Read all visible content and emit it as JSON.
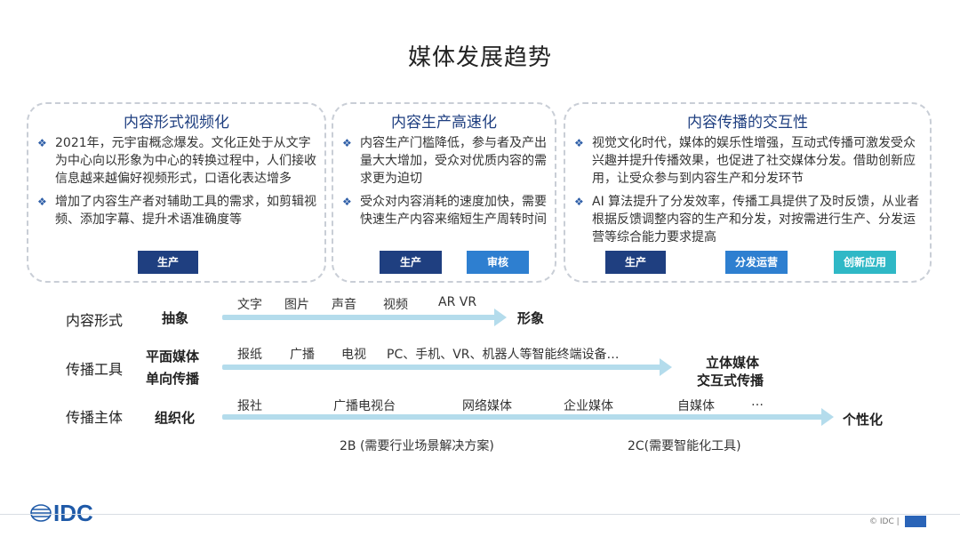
{
  "title": "媒体发展趋势",
  "panels": [
    {
      "title": "内容形式视频化",
      "bullets": [
        "2021年，元宇宙概念爆发。文化正处于从文字为中心向以形象为中心的转换过程中，人们接收信息越来越偏好视频形式，口语化表达增多",
        "增加了内容生产者对辅助工具的需求，如剪辑视频、添加字幕、提升术语准确度等"
      ],
      "tags": [
        "生产"
      ]
    },
    {
      "title": "内容生产高速化",
      "bullets": [
        "内容生产门槛降低，参与者及产出量大大增加，受众对优质内容的需求更为迫切",
        "受众对内容消耗的速度加快，需要快速生产内容来缩短生产周转时间"
      ],
      "tags": [
        "生产",
        "审核"
      ]
    },
    {
      "title": "内容传播的交互性",
      "bullets": [
        "视觉文化时代，媒体的娱乐性增强，互动式传播可激发受众兴趣并提升传播效果，也促进了社交媒体分发。借助创新应用，让受众参与到内容生产和分发环节",
        "AI 算法提升了分发效率，传播工具提供了及时反馈，从业者根据反馈调整内容的生产和分发，对按需进行生产、分发运营等综合能力要求提高"
      ],
      "tags": [
        "生产",
        "分发运营",
        "创新应用"
      ]
    }
  ],
  "bullet_icon": "diamond-bullet-icon",
  "rows": [
    {
      "label": "内容形式",
      "start": [
        "抽象"
      ],
      "items": [
        "文字",
        "图片",
        "声音",
        "视频",
        "AR VR"
      ],
      "end": [
        "形象"
      ]
    },
    {
      "label": "传播工具",
      "start": [
        "平面媒体",
        "单向传播"
      ],
      "items": [
        "报纸",
        "广播",
        "电视",
        "PC、手机、VR、机器人等智能终端设备…"
      ],
      "end": [
        "立体媒体",
        "交互式传播"
      ]
    },
    {
      "label": "传播主体",
      "start": [
        "组织化"
      ],
      "items": [
        "报社",
        "广播电视台",
        "网络媒体",
        "企业媒体",
        "自媒体",
        "…"
      ],
      "end": [
        "个性化"
      ],
      "notes": [
        "2B (需要行业场景解决方案)",
        "2C(需要智能化工具)"
      ]
    }
  ],
  "footer": {
    "logo": "IDC",
    "copyright": "© IDC |"
  },
  "colors": {
    "tag_dark": "#1f3f80",
    "tag_blue": "#2e7fd0",
    "tag_teal": "#2fb8c6",
    "arrow": "#b4dcec",
    "panel_border": "#c9ced6",
    "title_blue": "#1f3f80"
  }
}
